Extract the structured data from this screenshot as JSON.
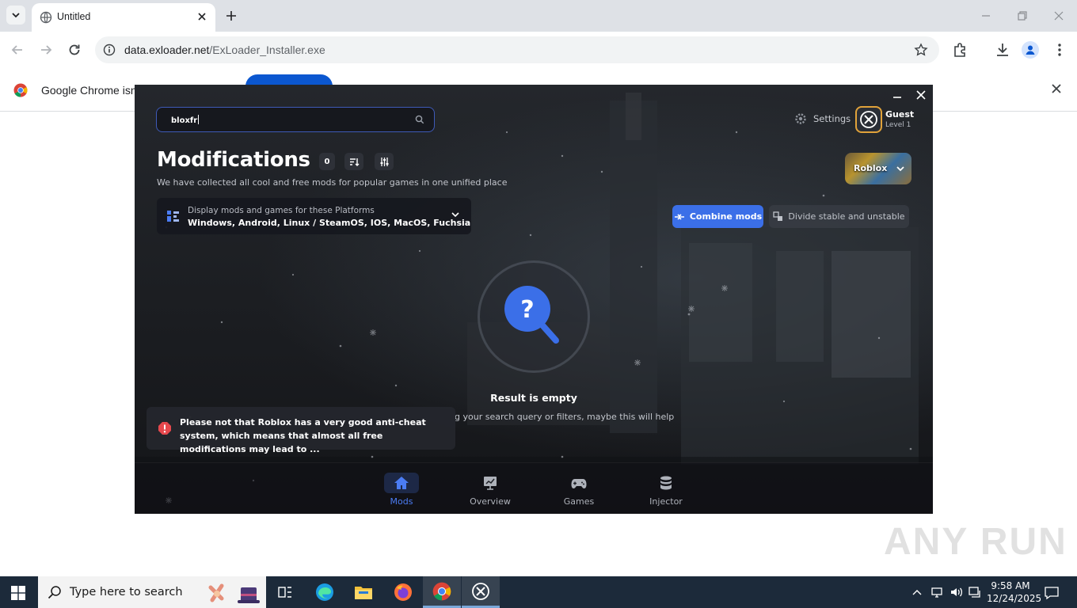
{
  "browser": {
    "tab_title": "Untitled",
    "url_host": "data.exloader.net",
    "url_path": "/ExLoader_Installer.exe",
    "infobar_text": "Google Chrome isn't"
  },
  "app": {
    "search_value": "bloxfr",
    "settings_label": "Settings",
    "user_name": "Guest",
    "user_level": "Level 1",
    "page_title": "Modifications",
    "mods_count": "0",
    "subtitle": "We have collected all cool and free mods for popular games in one unified place",
    "platforms_label": "Display mods and games for these Platforms",
    "platforms_value": "Windows, Android, Linux / SteamOS, IOS, MacOS, Fuchsia",
    "game_selected": "Roblox",
    "combine_label": "Combine mods",
    "divide_label": "Divide stable and unstable",
    "empty_title": "Result is empty",
    "empty_hint": "g your search query or filters, maybe this will help",
    "warning_text": "Please not that Roblox has a very good anti-cheat system, which means that almost all free modifications may lead to ...",
    "nav": [
      {
        "label": "Mods",
        "active": true
      },
      {
        "label": "Overview"
      },
      {
        "label": "Games"
      },
      {
        "label": "Injector"
      }
    ],
    "accent_color": "#3b6fe8"
  },
  "taskbar": {
    "search_placeholder": "Type here to search",
    "time": "9:58 AM",
    "date": "12/24/2025"
  },
  "watermark": "ANY RUN"
}
